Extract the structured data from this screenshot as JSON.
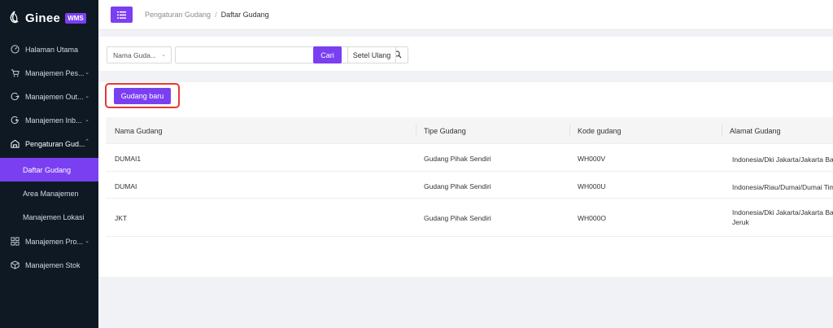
{
  "app": {
    "logo_text": "Ginee",
    "logo_badge": "WMS",
    "accent": "#7b3ff2",
    "sidebar_bg": "#0f1923"
  },
  "sidebar": {
    "items": [
      {
        "label": "Halaman Utama",
        "icon": "speedometer-icon"
      },
      {
        "label": "Manajemen Pes...",
        "icon": "cart-icon"
      },
      {
        "label": "Manajemen Out...",
        "icon": "outbound-icon"
      },
      {
        "label": "Manajemen Inb...",
        "icon": "inbound-icon"
      },
      {
        "label": "Pengaturan Gud...",
        "icon": "warehouse-icon"
      },
      {
        "label": "Daftar Gudang"
      },
      {
        "label": "Area Manajemen"
      },
      {
        "label": "Manajemen Lokasi"
      },
      {
        "label": "Manajemen Pro...",
        "icon": "product-icon"
      },
      {
        "label": "Manajemen Stok",
        "icon": "stock-icon"
      }
    ]
  },
  "breadcrumb": {
    "parent": "Pengaturan Gudang",
    "separator": "/",
    "current": "Daftar Gudang"
  },
  "filters": {
    "select_value": "Nama Guda...",
    "search_value": "",
    "search_button": "Cari",
    "reset_button": "Setel Ulang"
  },
  "actions": {
    "new_button": "Gudang baru"
  },
  "table": {
    "headers": [
      "Nama Gudang",
      "Tipe Gudang",
      "Kode gudang",
      "Alamat Gudang"
    ],
    "rows": [
      {
        "name": "DUMAI1",
        "type": "Gudang Pihak Sendiri",
        "code": "WH000V",
        "address": "Indonesia/Dki Jakarta/Jakarta Bar"
      },
      {
        "name": "DUMAI",
        "type": "Gudang Pihak Sendiri",
        "code": "WH000U",
        "address": "Indonesia/Riau/Dumai/Dumai Tim"
      },
      {
        "name": "JKT",
        "type": "Gudang Pihak Sendiri",
        "code": "WH000O",
        "address": "Indonesia/Dki Jakarta/Jakarta Bar\nJeruk"
      }
    ]
  }
}
